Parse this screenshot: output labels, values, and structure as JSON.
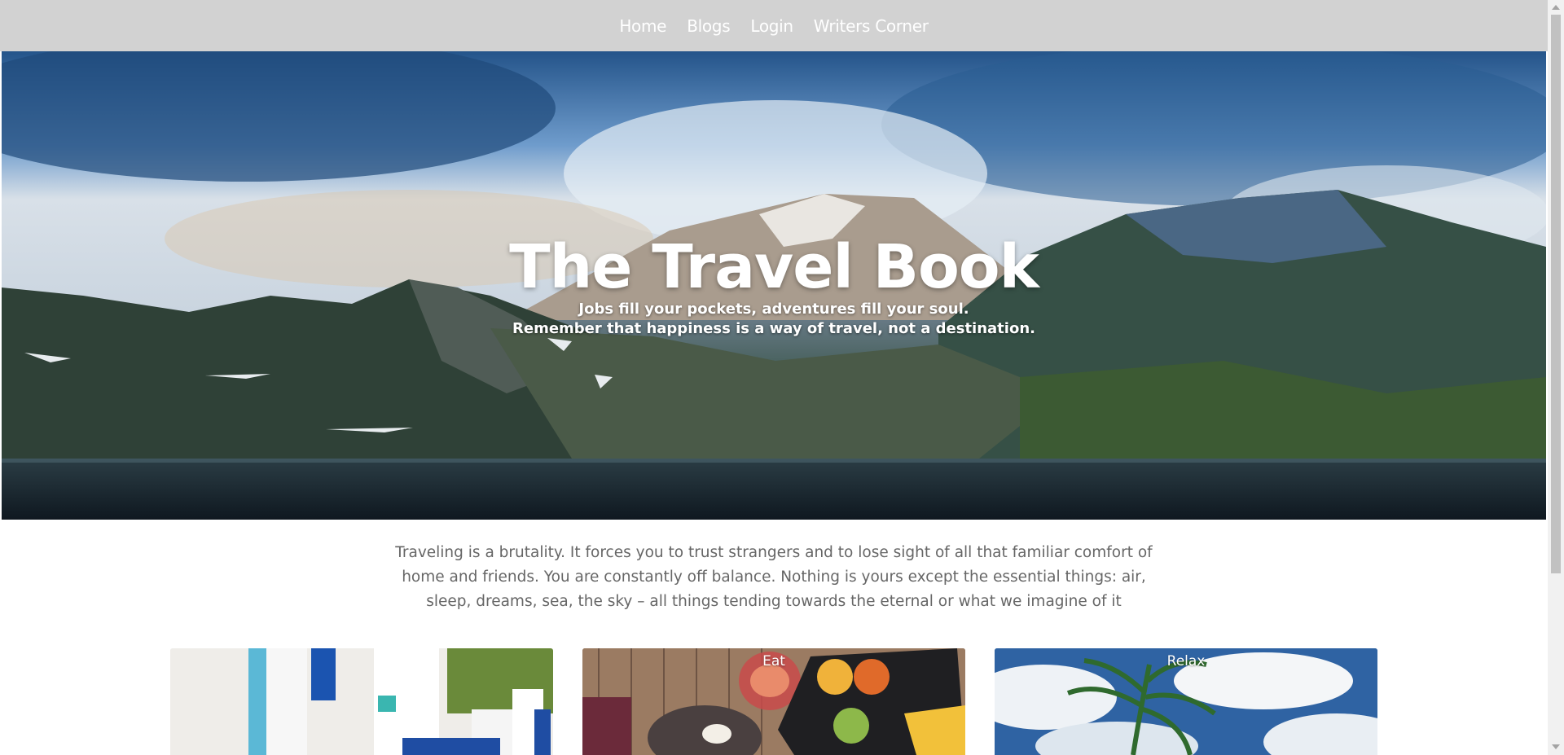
{
  "nav": {
    "items": [
      {
        "label": "Home"
      },
      {
        "label": "Blogs"
      },
      {
        "label": "Login"
      },
      {
        "label": "Writers Corner"
      }
    ]
  },
  "hero": {
    "title": "The Travel Book",
    "line1": "Jobs fill your pockets, adventures fill your soul.",
    "line2": "Remember that happiness is a way of travel, not a destination."
  },
  "intro": {
    "text": "Traveling is a brutality. It forces you to trust strangers and to lose sight of all that familiar comfort of home and friends. You are constantly off balance. Nothing is yours except the essential things: air, sleep, dreams, sea, the sky – all things tending towards the eternal or what we imagine of it"
  },
  "cards": [
    {
      "label": ""
    },
    {
      "label": "Eat"
    },
    {
      "label": "Relax"
    }
  ],
  "colors": {
    "navbar_bg": "#d2d2d2",
    "nav_text": "#ffffff",
    "intro_text": "#666666"
  }
}
